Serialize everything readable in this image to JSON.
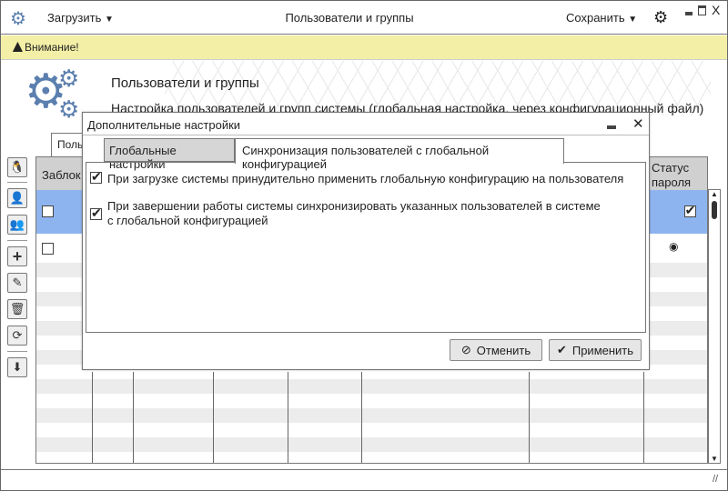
{
  "topbar": {
    "load_label": "Загрузить",
    "title": "Пользователи и группы",
    "save_label": "Сохранить"
  },
  "warning": {
    "text": "Внимание!"
  },
  "header": {
    "title": "Пользователи и группы",
    "subtitle": "Настройка пользователей и групп системы (глобальная настройка, через конфигурационный файл)"
  },
  "main": {
    "tab_label": "Поль",
    "columns": {
      "locked": "Заблок",
      "password_status": "Статус пароля"
    }
  },
  "dialog": {
    "title": "Дополнительные настройки",
    "tabs": [
      {
        "label": "Глобальные настройки"
      },
      {
        "label": "Синхронизация пользователей с глобальной конфигурацией"
      }
    ],
    "options": [
      {
        "label": "При загрузке системы принудительно применить глобальную конфигурацию на пользователя",
        "checked": true
      },
      {
        "label": "При завершении работы системы синхронизировать указанных пользователей в системе",
        "label2": "с глобальной конфигурацией",
        "checked": true
      }
    ],
    "cancel_label": "Отменить",
    "apply_label": "Применить"
  },
  "colors": {
    "accent": "#5b7fae",
    "warning_bg": "#f3efa6",
    "selected_row": "#8db4ef"
  }
}
